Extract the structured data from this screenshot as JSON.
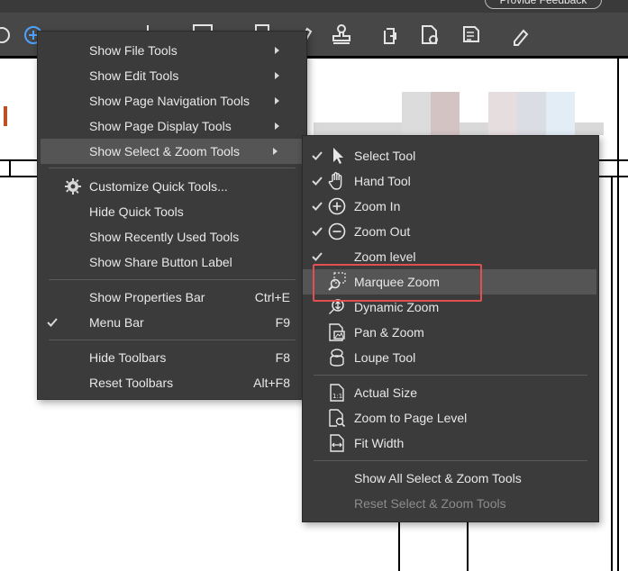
{
  "toolbar": {
    "feedback_label": "Provide Feedback",
    "icons": [
      "zoom-in-icon",
      "crop-icon",
      "keyboard-icon",
      "pages-icon",
      "pen-icon",
      "stamp-icon",
      "page-rotate-icon",
      "page-insert-icon",
      "edit-doc-icon",
      "highlighter-icon"
    ]
  },
  "main_menu": {
    "items": [
      {
        "label": "Show File Tools",
        "submenu": true
      },
      {
        "label": "Show Edit Tools",
        "submenu": true
      },
      {
        "label": "Show Page Navigation Tools",
        "submenu": true
      },
      {
        "label": "Show Page Display Tools",
        "submenu": true
      },
      {
        "label": "Show Select & Zoom Tools",
        "submenu": true,
        "highlighted": true
      },
      {
        "label": "Customize Quick Tools...",
        "icon": "gear-icon"
      },
      {
        "label": "Hide Quick Tools"
      },
      {
        "label": "Show Recently Used Tools"
      },
      {
        "label": "Show Share Button Label"
      },
      {
        "label": "Show Properties Bar",
        "shortcut": "Ctrl+E"
      },
      {
        "label": "Menu Bar",
        "shortcut": "F9",
        "checked": true
      },
      {
        "label": "Hide Toolbars",
        "shortcut": "F8"
      },
      {
        "label": "Reset Toolbars",
        "shortcut": "Alt+F8"
      }
    ]
  },
  "submenu": {
    "items": [
      {
        "label": "Select Tool",
        "checked": true,
        "icon": "cursor-icon"
      },
      {
        "label": "Hand Tool",
        "checked": true,
        "icon": "hand-icon"
      },
      {
        "label": "Zoom In",
        "checked": true,
        "icon": "zoom-in-circle-icon"
      },
      {
        "label": "Zoom Out",
        "checked": true,
        "icon": "zoom-out-circle-icon"
      },
      {
        "label": "Zoom level",
        "checked": true
      },
      {
        "label": "Marquee Zoom",
        "icon": "marquee-zoom-icon",
        "highlighted": true
      },
      {
        "label": "Dynamic Zoom",
        "icon": "dynamic-zoom-icon"
      },
      {
        "label": "Pan & Zoom",
        "icon": "pan-zoom-icon"
      },
      {
        "label": "Loupe Tool",
        "icon": "loupe-icon"
      },
      {
        "label": "Actual Size",
        "icon": "actual-size-icon"
      },
      {
        "label": "Zoom to Page Level",
        "icon": "zoom-page-icon"
      },
      {
        "label": "Fit Width",
        "icon": "fit-width-icon"
      },
      {
        "label": "Show All Select & Zoom Tools"
      },
      {
        "label": "Reset Select & Zoom Tools",
        "disabled": true
      }
    ]
  },
  "colors": {
    "menu_bg": "#3b3b3b",
    "highlight": "#555555",
    "toolbar": "#474747",
    "callout": "#e05050"
  }
}
